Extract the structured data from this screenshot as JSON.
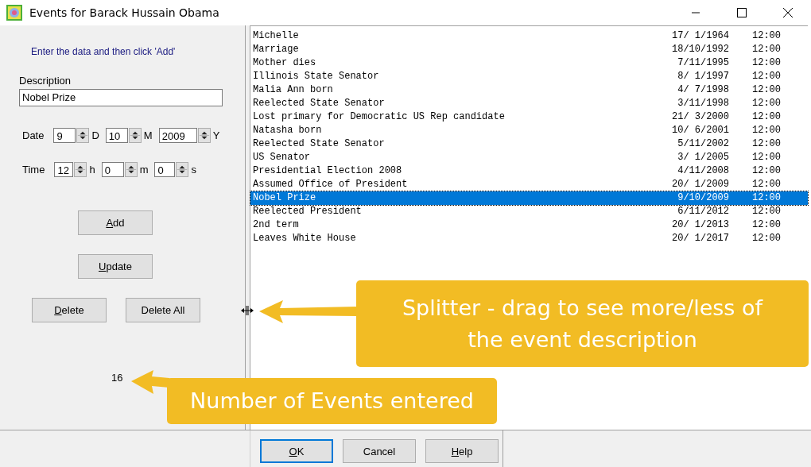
{
  "window": {
    "title": "Events for Barack Hussain Obama"
  },
  "form": {
    "instruction": "Enter the data and then click 'Add'",
    "description_label": "Description",
    "description_value": "Nobel Prize",
    "date_label": "Date",
    "date": [
      {
        "value": "9",
        "unit": "D"
      },
      {
        "value": "10",
        "unit": "M"
      },
      {
        "value": "2009",
        "unit": "Y"
      }
    ],
    "time_label": "Time",
    "time": [
      {
        "value": "12",
        "unit": "h"
      },
      {
        "value": "0",
        "unit": "m"
      },
      {
        "value": "0",
        "unit": "s"
      }
    ],
    "add_button": {
      "label": "Add",
      "first_letter_underlined": true
    },
    "update_button": {
      "label": "Update",
      "first_letter_underlined": true
    },
    "delete_button": {
      "label": "Delete",
      "first_letter_underlined": true
    },
    "delete_all_button": {
      "label": "Delete All",
      "first_letter_underlined": false
    },
    "event_count": "16"
  },
  "events": [
    {
      "description": "Michelle",
      "date": "17/ 1/1964",
      "time": "12:00",
      "selected": false
    },
    {
      "description": "Marriage",
      "date": "18/10/1992",
      "time": "12:00",
      "selected": false
    },
    {
      "description": "Mother dies",
      "date": "7/11/1995",
      "time": "12:00",
      "selected": false
    },
    {
      "description": "Illinois State Senator",
      "date": "8/ 1/1997",
      "time": "12:00",
      "selected": false
    },
    {
      "description": "Malia Ann born",
      "date": "4/ 7/1998",
      "time": "12:00",
      "selected": false
    },
    {
      "description": "Reelected State Senator",
      "date": "3/11/1998",
      "time": "12:00",
      "selected": false
    },
    {
      "description": "Lost primary for Democratic US Rep candidate",
      "date": "21/ 3/2000",
      "time": "12:00",
      "selected": false
    },
    {
      "description": "Natasha born",
      "date": "10/ 6/2001",
      "time": "12:00",
      "selected": false
    },
    {
      "description": "Reelected State Senator",
      "date": "5/11/2002",
      "time": "12:00",
      "selected": false
    },
    {
      "description": "US Senator",
      "date": "3/ 1/2005",
      "time": "12:00",
      "selected": false
    },
    {
      "description": "Presidential Election 2008",
      "date": "4/11/2008",
      "time": "12:00",
      "selected": false
    },
    {
      "description": "Assumed Office of President",
      "date": "20/ 1/2009",
      "time": "12:00",
      "selected": false
    },
    {
      "description": "Nobel Prize",
      "date": "9/10/2009",
      "time": "12:00",
      "selected": true
    },
    {
      "description": "Reelected President",
      "date": "6/11/2012",
      "time": "12:00",
      "selected": false
    },
    {
      "description": "2nd term",
      "date": "20/ 1/2013",
      "time": "12:00",
      "selected": false
    },
    {
      "description": "Leaves White House",
      "date": "20/ 1/2017",
      "time": "12:00",
      "selected": false
    }
  ],
  "dialog_buttons": [
    {
      "label": "OK",
      "first_letter_underlined": true,
      "default": true
    },
    {
      "label": "Cancel",
      "first_letter_underlined": false,
      "default": false
    },
    {
      "label": "Help",
      "first_letter_underlined": true,
      "default": false
    }
  ],
  "callouts": [
    {
      "text": "Splitter - drag to see more/less of the event description",
      "kind": "splitter"
    },
    {
      "text": "Number of Events entered",
      "kind": "count"
    }
  ]
}
